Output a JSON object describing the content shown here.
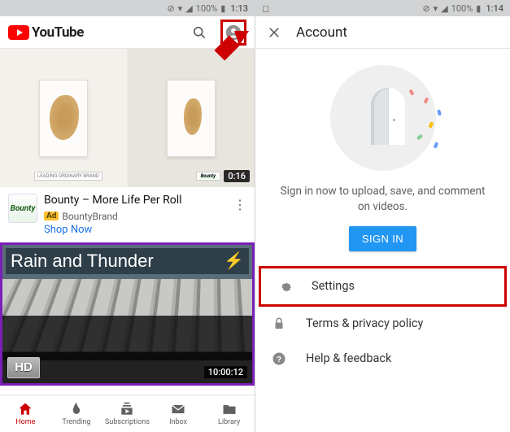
{
  "status": {
    "battery": "100%",
    "time": "1:14",
    "battery_icon": "▮",
    "signal": "◢",
    "wifi": "▾",
    "square": "◻",
    "misc": "⊘"
  },
  "left": {
    "brand": "YouTube",
    "video1": {
      "title": "Bounty – More Life Per Roll",
      "channel": "BountyBrand",
      "ad_label": "Ad",
      "shop": "Shop Now",
      "duration": "0:16",
      "brand_small": "Bounty",
      "tag_left": "LEADING ORDINARY BRAND"
    },
    "video2": {
      "overlay_title": "Rain and Thunder",
      "duration": "10:00:12",
      "hd": "HD"
    },
    "nav": {
      "home": "Home",
      "trending": "Trending",
      "subs": "Subscriptions",
      "inbox": "Inbox",
      "library": "Library"
    }
  },
  "right": {
    "title": "Account",
    "signin_msg": "Sign in now to upload, save, and comment on videos.",
    "signin_btn": "SIGN IN",
    "menu": {
      "settings": "Settings",
      "terms": "Terms & privacy policy",
      "help": "Help & feedback"
    }
  }
}
